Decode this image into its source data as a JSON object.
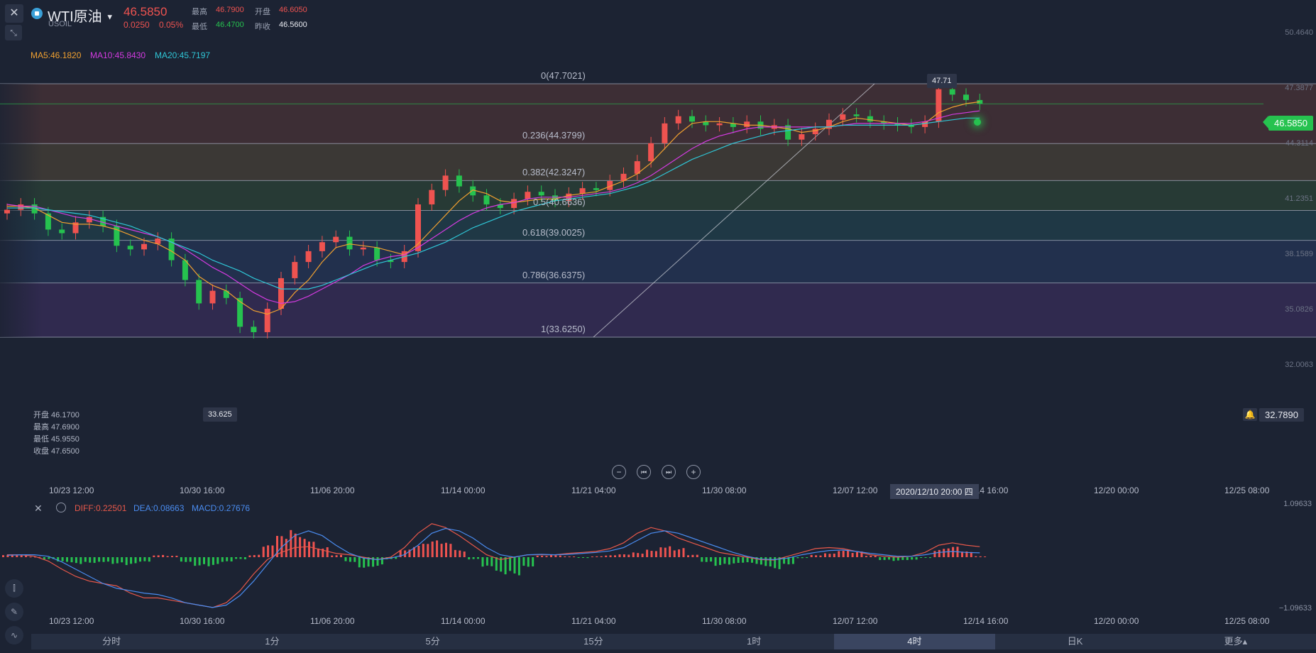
{
  "header": {
    "symbol": "WTI原油",
    "code": "USOIL",
    "price": "46.5850",
    "change": "0.0250",
    "change_pct": "0.05%",
    "high_label": "最高",
    "high": "46.7900",
    "open_label": "开盘",
    "open": "46.6050",
    "low_label": "最低",
    "low": "46.4700",
    "prev_label": "昨收",
    "prev": "46.5600"
  },
  "ma_legend": {
    "ma5": "MA5:46.1820",
    "ma10": "MA10:45.8430",
    "ma20": "MA20:45.7197"
  },
  "colors": {
    "up": "#ef5350",
    "down": "#26c24f",
    "ma5": "#f0a030",
    "ma10": "#d33be0",
    "ma20": "#2fc6d6",
    "diff": "#e8584a",
    "dea": "#4a8cf0",
    "fib_line": "#9aa1b2"
  },
  "price_axis": [
    "50.4640",
    "47.3877",
    "44.3114",
    "41.2351",
    "38.1589",
    "35.0826",
    "32.0063"
  ],
  "current_price_tag": "46.5850",
  "alert_price": "32.7890",
  "peak_label": "47.71",
  "trough_label": "33.625",
  "fib_labels": [
    "0(47.7021)",
    "0.236(44.3799)",
    "0.382(42.3247)",
    "0.5(40.6636)",
    "0.618(39.0025)",
    "0.786(36.6375)",
    "1(33.6250)"
  ],
  "ohlc_info": {
    "open": "开盘 46.1700",
    "high": "最高 47.6900",
    "low": "最低 45.9550",
    "close": "收盘 47.6500"
  },
  "time_axis": [
    "10/23 12:00",
    "10/30 16:00",
    "11/06 20:00",
    "11/14 00:00",
    "11/21 04:00",
    "11/30 08:00",
    "12/07 12:00",
    "12/14 16:00",
    "12/20 00:00",
    "12/25 08:00"
  ],
  "crosshair_time": "2020/12/10 20:00 四",
  "macd_legend": {
    "diff": "DIFF:0.22501",
    "dea": "DEA:0.08663",
    "macd": "MACD:0.27676"
  },
  "macd_axis": [
    "1.09633",
    "−1.09633"
  ],
  "period_tabs": [
    "分时",
    "1分",
    "5分",
    "15分",
    "1时",
    "4时",
    "日K",
    "更多▴"
  ],
  "chart_data": [
    {
      "type": "candlestick",
      "ylim": [
        32.0063,
        50.464
      ],
      "series": [
        {
          "name": "price",
          "values": [
            40.7,
            41.0,
            40.5,
            39.6,
            39.4,
            40.0,
            40.3,
            39.8,
            38.7,
            38.5,
            38.8,
            39.1,
            37.9,
            36.8,
            35.5,
            36.2,
            35.8,
            34.2,
            33.9,
            35.2,
            36.9,
            37.8,
            38.4,
            38.9,
            39.2,
            38.5,
            38.6,
            37.9,
            37.8,
            38.4,
            41.0,
            41.8,
            42.6,
            42.0,
            41.5,
            41.0,
            40.8,
            41.3,
            41.7,
            41.5,
            41.2,
            41.6,
            41.9,
            41.8,
            42.3,
            42.7,
            43.4,
            44.4,
            45.5,
            45.9,
            45.6,
            45.4,
            45.5,
            45.3,
            45.6,
            45.2,
            45.4,
            44.6,
            44.9,
            45.2,
            45.7,
            46.0,
            45.9,
            45.6,
            45.5,
            45.4,
            45.3,
            45.6,
            47.4,
            47.1,
            46.8,
            46.6
          ]
        },
        {
          "name": "MA5",
          "values": [
            40.9,
            40.9,
            40.8,
            40.4,
            40.0,
            39.9,
            39.9,
            39.8,
            39.6,
            39.3,
            39.0,
            38.8,
            38.4,
            37.9,
            37.0,
            36.5,
            36.2,
            35.6,
            35.1,
            34.9,
            35.2,
            36.1,
            36.8,
            37.8,
            38.6,
            38.8,
            38.7,
            38.6,
            38.4,
            38.2,
            38.8,
            39.6,
            40.4,
            41.2,
            41.8,
            41.6,
            41.2,
            41.1,
            41.2,
            41.3,
            41.3,
            41.5,
            41.6,
            41.7,
            42.0,
            42.3,
            42.7,
            43.3,
            44.1,
            44.9,
            45.5,
            45.6,
            45.6,
            45.5,
            45.4,
            45.4,
            45.3,
            45.2,
            45.0,
            45.1,
            45.3,
            45.6,
            45.8,
            45.7,
            45.6,
            45.5,
            45.4,
            45.5,
            46.1,
            46.4,
            46.6,
            46.7
          ]
        },
        {
          "name": "MA10",
          "values": [
            41.0,
            40.9,
            40.9,
            40.7,
            40.5,
            40.3,
            40.2,
            40.0,
            39.8,
            39.6,
            39.4,
            39.2,
            38.9,
            38.5,
            38.0,
            37.5,
            37.1,
            36.6,
            36.1,
            35.7,
            35.5,
            35.6,
            35.9,
            36.3,
            36.7,
            37.1,
            37.6,
            37.9,
            38.1,
            38.2,
            38.6,
            39.1,
            39.6,
            40.1,
            40.5,
            40.8,
            41.0,
            41.1,
            41.3,
            41.4,
            41.4,
            41.4,
            41.5,
            41.6,
            41.7,
            41.9,
            42.2,
            42.6,
            43.1,
            43.6,
            44.1,
            44.5,
            44.8,
            45.0,
            45.2,
            45.3,
            45.3,
            45.3,
            45.3,
            45.3,
            45.3,
            45.4,
            45.5,
            45.5,
            45.5,
            45.5,
            45.5,
            45.6,
            45.8,
            46.0,
            46.1,
            46.2
          ]
        },
        {
          "name": "MA20",
          "values": [
            40.8,
            40.8,
            40.8,
            40.7,
            40.6,
            40.5,
            40.4,
            40.2,
            40.0,
            39.8,
            39.5,
            39.2,
            38.9,
            38.6,
            38.3,
            37.9,
            37.6,
            37.3,
            36.9,
            36.6,
            36.3,
            36.3,
            36.3,
            36.5,
            36.8,
            37.1,
            37.4,
            37.7,
            37.9,
            38.1,
            38.3,
            38.6,
            38.9,
            39.3,
            39.7,
            40.0,
            40.3,
            40.6,
            40.8,
            41.0,
            41.2,
            41.3,
            41.4,
            41.5,
            41.6,
            41.8,
            42.0,
            42.3,
            42.7,
            43.1,
            43.5,
            43.8,
            44.1,
            44.4,
            44.6,
            44.8,
            45.0,
            45.1,
            45.2,
            45.3,
            45.3,
            45.4,
            45.4,
            45.4,
            45.4,
            45.4,
            45.4,
            45.5,
            45.6,
            45.7,
            45.8,
            45.8
          ]
        }
      ]
    },
    {
      "type": "bar",
      "ylim": [
        -1.09633,
        1.09633
      ],
      "series": [
        {
          "name": "MACD",
          "values": [
            0.05,
            0.04,
            0.01,
            -0.05,
            -0.12,
            -0.15,
            -0.12,
            -0.1,
            -0.14,
            -0.18,
            -0.12,
            0.05,
            0.03,
            -0.1,
            -0.18,
            -0.2,
            -0.12,
            -0.05,
            0.05,
            0.25,
            0.45,
            0.58,
            0.45,
            0.25,
            0.05,
            -0.1,
            -0.22,
            -0.2,
            -0.05,
            0.2,
            0.3,
            0.35,
            0.3,
            0.15,
            -0.05,
            -0.25,
            -0.4,
            -0.38,
            -0.2,
            0.03,
            0.05,
            0.02,
            -0.02,
            0.02,
            0.04,
            0.06,
            0.1,
            0.18,
            0.28,
            0.2,
            0.05,
            -0.1,
            -0.18,
            -0.17,
            -0.15,
            -0.2,
            -0.25,
            -0.15,
            -0.02,
            0.05,
            0.1,
            0.18,
            0.12,
            0.03,
            -0.06,
            -0.08,
            -0.07,
            -0.02,
            0.18,
            0.22,
            0.12,
            0.02
          ]
        },
        {
          "name": "DIFF",
          "values": [
            0.05,
            0.05,
            0.02,
            -0.08,
            -0.25,
            -0.4,
            -0.5,
            -0.55,
            -0.6,
            -0.75,
            -0.85,
            -0.85,
            -0.9,
            -0.95,
            -1.0,
            -1.05,
            -0.95,
            -0.7,
            -0.35,
            -0.05,
            0.1,
            0.2,
            0.22,
            0.15,
            0.08,
            0.05,
            0.0,
            -0.05,
            0.0,
            0.2,
            0.5,
            0.7,
            0.62,
            0.45,
            0.25,
            0.05,
            -0.05,
            0.0,
            0.05,
            0.05,
            0.05,
            0.08,
            0.1,
            0.12,
            0.18,
            0.3,
            0.5,
            0.62,
            0.55,
            0.4,
            0.3,
            0.2,
            0.1,
            0.05,
            0.0,
            -0.05,
            -0.06,
            0.02,
            0.1,
            0.18,
            0.2,
            0.18,
            0.12,
            0.05,
            0.02,
            0.0,
            0.02,
            0.1,
            0.25,
            0.3,
            0.25,
            0.22
          ]
        },
        {
          "name": "DEA",
          "values": [
            0.04,
            0.05,
            0.05,
            0.02,
            -0.1,
            -0.25,
            -0.4,
            -0.55,
            -0.65,
            -0.7,
            -0.75,
            -0.78,
            -0.85,
            -0.95,
            -1.0,
            -1.05,
            -1.0,
            -0.8,
            -0.5,
            -0.15,
            0.2,
            0.45,
            0.55,
            0.45,
            0.25,
            0.08,
            -0.02,
            -0.05,
            -0.02,
            0.05,
            0.25,
            0.5,
            0.6,
            0.55,
            0.4,
            0.2,
            0.05,
            0.0,
            0.05,
            0.06,
            0.05,
            0.06,
            0.08,
            0.1,
            0.13,
            0.2,
            0.35,
            0.5,
            0.55,
            0.5,
            0.4,
            0.3,
            0.2,
            0.1,
            0.02,
            -0.04,
            -0.05,
            -0.02,
            0.05,
            0.1,
            0.14,
            0.15,
            0.12,
            0.08,
            0.05,
            0.02,
            0.02,
            0.05,
            0.1,
            0.12,
            0.1,
            0.09
          ]
        }
      ]
    }
  ]
}
